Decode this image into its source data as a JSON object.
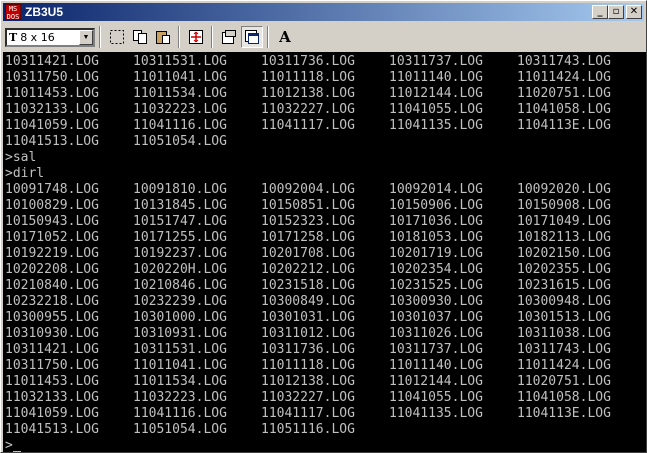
{
  "window": {
    "title": "ZB3U5",
    "icon_label": "MS DOS",
    "buttons": {
      "minimize": "_",
      "restore": "▫",
      "close": "✕"
    }
  },
  "toolbar": {
    "font_size": "8 x 16",
    "font_icon": "T",
    "tools": [
      "mark-icon",
      "copy-icon",
      "paste-icon",
      "fullscreen-icon",
      "properties-icon",
      "background-icon",
      "font-icon"
    ]
  },
  "console": {
    "lines": [
      [
        "10311421.LOG",
        "10311531.LOG",
        "10311736.LOG",
        "10311737.LOG",
        "10311743.LOG"
      ],
      [
        "10311750.LOG",
        "11011041.LOG",
        "11011118.LOG",
        "11011140.LOG",
        "11011424.LOG"
      ],
      [
        "11011453.LOG",
        "11011534.LOG",
        "11012138.LOG",
        "11012144.LOG",
        "11020751.LOG"
      ],
      [
        "11032133.LOG",
        "11032223.LOG",
        "11032227.LOG",
        "11041055.LOG",
        "11041058.LOG"
      ],
      [
        "11041059.LOG",
        "11041116.LOG",
        "11041117.LOG",
        "11041135.LOG",
        "1104113E.LOG"
      ],
      [
        "11041513.LOG",
        "11051054.LOG"
      ],
      [
        ">sal"
      ],
      [
        ">dirl"
      ],
      [
        "10091748.LOG",
        "10091810.LOG",
        "10092004.LOG",
        "10092014.LOG",
        "10092020.LOG"
      ],
      [
        "10100829.LOG",
        "10131845.LOG",
        "10150851.LOG",
        "10150906.LOG",
        "10150908.LOG"
      ],
      [
        "10150943.LOG",
        "10151747.LOG",
        "10152323.LOG",
        "10171036.LOG",
        "10171049.LOG"
      ],
      [
        "10171052.LOG",
        "10171255.LOG",
        "10171258.LOG",
        "10181053.LOG",
        "10182113.LOG"
      ],
      [
        "10192219.LOG",
        "10192237.LOG",
        "10201708.LOG",
        "10201719.LOG",
        "10202150.LOG"
      ],
      [
        "10202208.LOG",
        "1020220H.LOG",
        "10202212.LOG",
        "10202354.LOG",
        "10202355.LOG"
      ],
      [
        "10210840.LOG",
        "10210846.LOG",
        "10231518.LOG",
        "10231525.LOG",
        "10231615.LOG"
      ],
      [
        "10232218.LOG",
        "10232239.LOG",
        "10300849.LOG",
        "10300930.LOG",
        "10300948.LOG"
      ],
      [
        "10300955.LOG",
        "10301000.LOG",
        "10301031.LOG",
        "10301037.LOG",
        "10301513.LOG"
      ],
      [
        "10310930.LOG",
        "10310931.LOG",
        "10311012.LOG",
        "10311026.LOG",
        "10311038.LOG"
      ],
      [
        "10311421.LOG",
        "10311531.LOG",
        "10311736.LOG",
        "10311737.LOG",
        "10311743.LOG"
      ],
      [
        "10311750.LOG",
        "11011041.LOG",
        "11011118.LOG",
        "11011140.LOG",
        "11011424.LOG"
      ],
      [
        "11011453.LOG",
        "11011534.LOG",
        "11012138.LOG",
        "11012144.LOG",
        "11020751.LOG"
      ],
      [
        "11032133.LOG",
        "11032223.LOG",
        "11032227.LOG",
        "11041055.LOG",
        "11041058.LOG"
      ],
      [
        "11041059.LOG",
        "11041116.LOG",
        "11041117.LOG",
        "11041135.LOG",
        "1104113E.LOG"
      ],
      [
        "11041513.LOG",
        "11051054.LOG",
        "11051116.LOG"
      ],
      [
        ">"
      ]
    ]
  },
  "colors": {
    "console_bg": "#000000",
    "console_fg": "#c0c0c0",
    "title_start": "#0a246a",
    "title_end": "#a6caf0"
  }
}
